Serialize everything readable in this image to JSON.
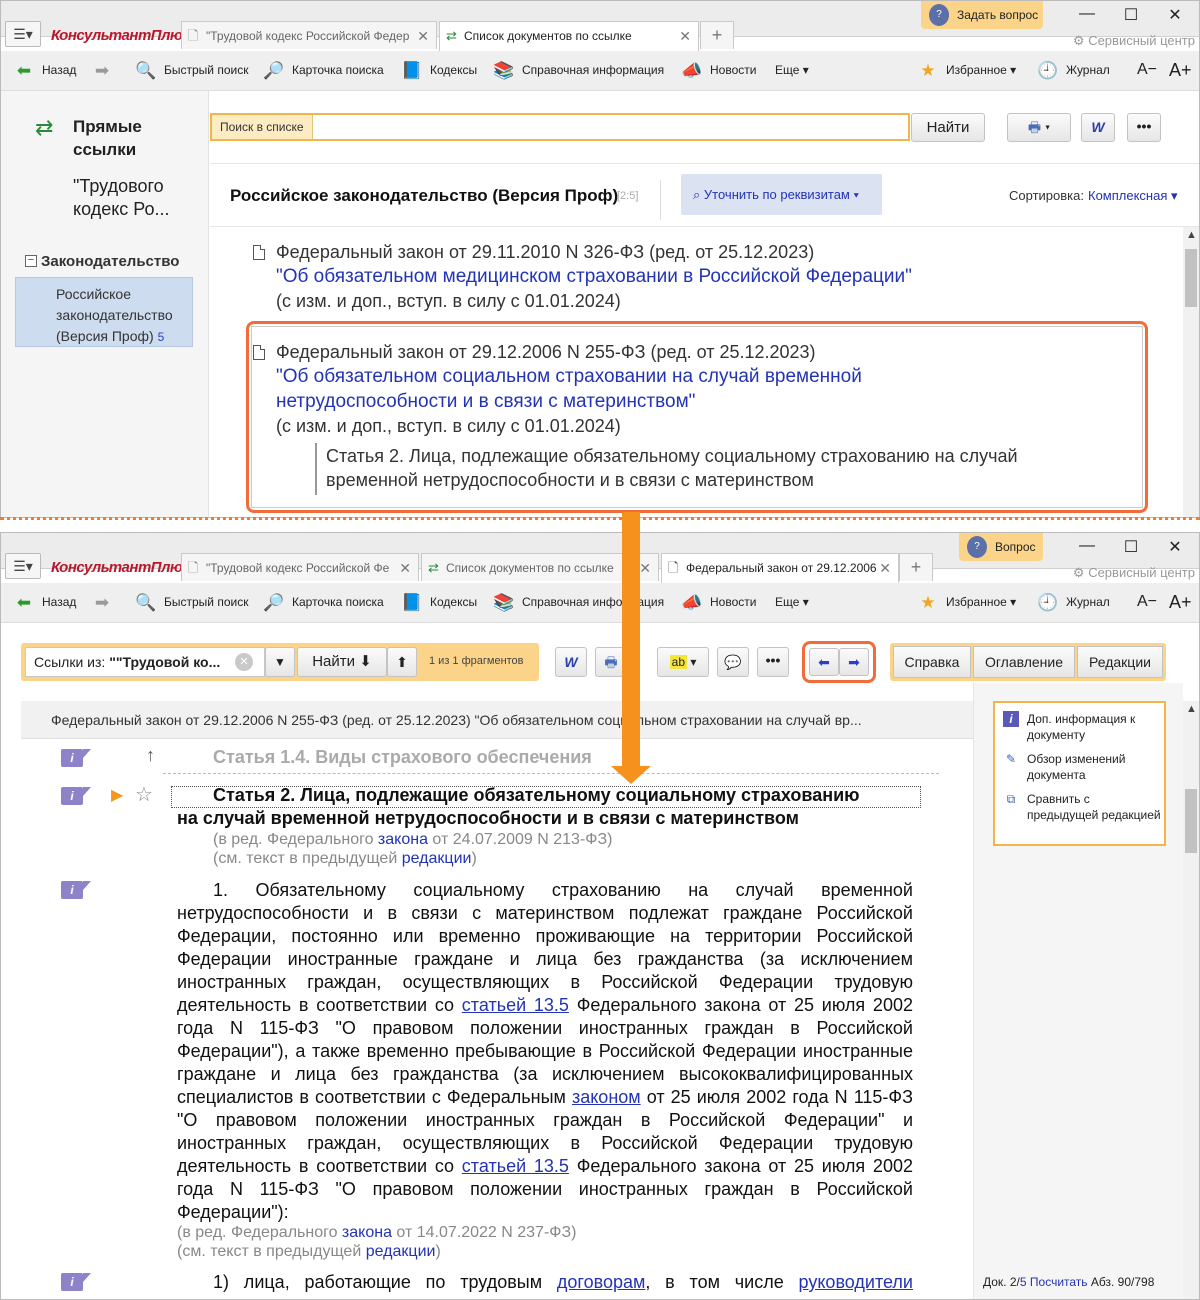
{
  "window1": {
    "logo": "КонсультантПлюс",
    "tabs": [
      {
        "label": "\"Трудовой кодекс Российской Федер"
      },
      {
        "label": "Список документов по ссылке"
      }
    ],
    "ask_label": "Задать вопрос",
    "service_center": "Сервисный центр",
    "toolbar": {
      "back": "Назад",
      "quick_search": "Быстрый поиск",
      "search_card": "Карточка поиска",
      "codes": "Кодексы",
      "reference": "Справочная информация",
      "news": "Новости",
      "more": "Еще",
      "favorites": "Избранное",
      "journal": "Журнал",
      "font_minus": "A−",
      "font_plus": "A+"
    },
    "sidebar": {
      "title": "Прямые ссылки",
      "subtitle": "\"Трудового кодекс Ро...",
      "group_label": "Законодательство",
      "group_item": "Российское законодательство (Версия Проф)",
      "group_count": "5"
    },
    "search": {
      "label": "Поиск в списке",
      "button": "Найти"
    },
    "list_header": {
      "title": "Российское законодательство (Версия Проф)",
      "range": "[2:5]",
      "refine": "Уточнить по реквизитам",
      "sort_label": "Сортировка:",
      "sort_value": "Комплексная"
    },
    "items": [
      {
        "meta": "Федеральный закон от 29.11.2010 N 326-ФЗ (ред. от 25.12.2023)",
        "title": "\"Об обязательном медицинском страховании в Российской Федерации\"",
        "note": "(с изм. и доп., вступ. в силу с 01.01.2024)"
      },
      {
        "meta": "Федеральный закон от 29.12.2006 N 255-ФЗ (ред. от 25.12.2023)",
        "title_line1": "\"Об обязательном социальном страховании на случай временной",
        "title_line2": "нетрудоспособности и в связи с материнством\"",
        "note": "(с изм. и доп., вступ. в силу с 01.01.2024)",
        "fragment_line1": "Статья 2. Лица, подлежащие обязательному социальному страхованию на случай",
        "fragment_line2": "временной нетрудоспособности и в связи с материнством"
      }
    ]
  },
  "window2": {
    "tabs": [
      {
        "label": "\"Трудовой кодекс Российской Фе"
      },
      {
        "label": "Список документов по ссылке"
      },
      {
        "label": "Федеральный закон от 29.12.2006"
      }
    ],
    "ask_label": "Вопрос",
    "search_combo": {
      "prefix": "Ссылки из: ",
      "value": "\"\"Трудовой ко..."
    },
    "find_button": "Найти",
    "fragments": "1 из 1 фрагментов",
    "right_buttons": [
      "Справка",
      "Оглавление",
      "Редакции"
    ],
    "doc_header": "Федеральный закон от 29.12.2006 N 255-ФЗ (ред. от 25.12.2023) \"Об обязательном социальном страховании на случай вр...",
    "prev_article": "Статья 1.4. Виды страхового обеспечения",
    "article_title_line1": "Статья 2. Лица, подлежащие обязательному социальному страхованию",
    "article_title_line2": "на случай временной нетрудоспособности и в связи с материнством",
    "note1": {
      "pre": "(в ред. Федерального ",
      "link": "закона",
      "post": " от 24.07.2009 N 213-ФЗ)"
    },
    "note2": {
      "pre": "(см. текст в предыдущей ",
      "link": "редакции",
      "post": ")"
    },
    "para1": {
      "t1": "1. Обязательному социальному страхованию на случай временной нетрудоспособности и в связи с материнством подлежат граждане Российской Федерации, постоянно или временно проживающие на территории Российской Федерации иностранные граждане и лица без гражданства (за исключением иностранных граждан, осуществляющих в Российской Федерации трудовую деятельность в соответствии со ",
      "l1": "статьей 13.5",
      "t2": " Федерального закона от 25 июля 2002 года N 115-ФЗ \"О правовом положении иностранных граждан в Российской Федерации\"), а также временно пребывающие в Российской Федерации иностранные граждане и лица без гражданства (за исключением высококвалифицированных специалистов в соответствии с Федеральным ",
      "l2": "законом",
      "t3": " от 25 июля 2002 года N 115-ФЗ \"О правовом положении иностранных граждан в Российской Федерации\" и иностранных граждан, осуществляющих в Российской Федерации трудовую деятельность в соответствии со ",
      "l3": "статьей 13.5",
      "t4": " Федерального закона от 25 июля 2002 года N 115-ФЗ \"О правовом положении иностранных граждан в Российской Федерации\"):"
    },
    "note3": {
      "pre": "(в ред. Федерального ",
      "link": "закона",
      "post": " от 14.07.2022 N 237-ФЗ)"
    },
    "note4": {
      "pre": "(см. текст в предыдущей ",
      "link": "редакции",
      "post": ")"
    },
    "para2": {
      "t1": "1) лица, работающие по трудовым ",
      "l1": "договорам",
      "t2": ", в том числе ",
      "l2": "руководители"
    },
    "right_panel": [
      "Доп. информация к документу",
      "Обзор изменений документа",
      "Сравнить с предыдущей редакцией"
    ],
    "status": {
      "doc": "Док. 2/",
      "doc_total": "5",
      "count_link": "Посчитать",
      "abz": "Абз. 90/798"
    }
  }
}
